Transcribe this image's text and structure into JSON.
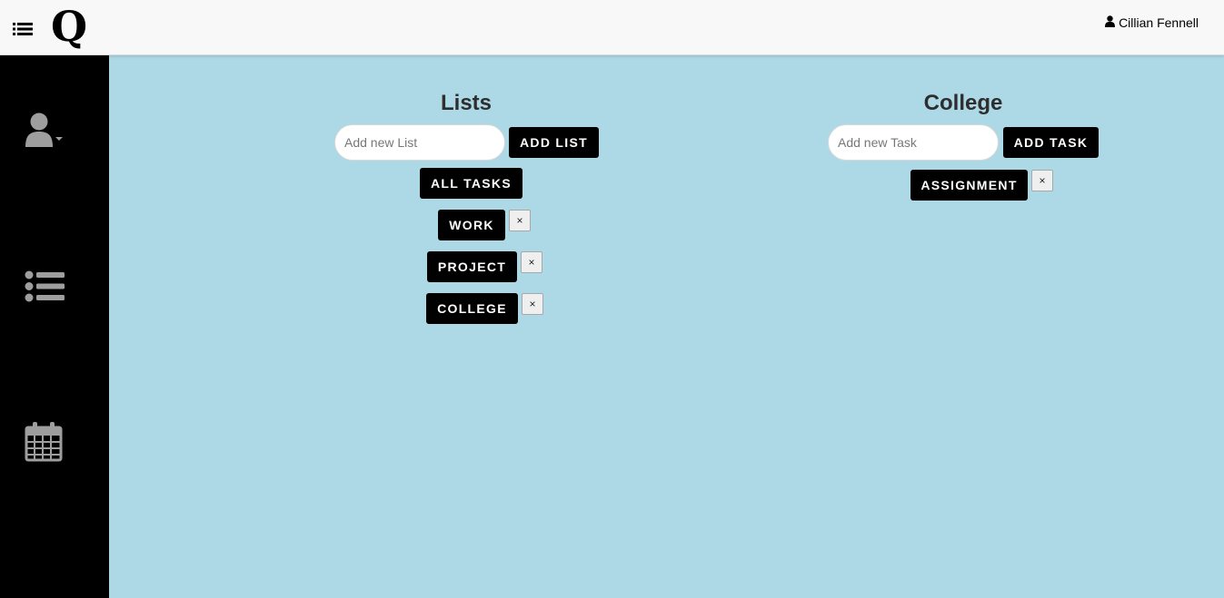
{
  "header": {
    "logo_text": "Q",
    "user_name": "Cillian Fennell",
    "icons": {
      "menu": "list-icon",
      "user": "user-icon"
    }
  },
  "sidebar": {
    "items": [
      {
        "icon": "user-profile-icon"
      },
      {
        "icon": "list-icon"
      },
      {
        "icon": "calendar-icon"
      }
    ]
  },
  "lists_panel": {
    "title": "Lists",
    "input_placeholder": "Add new List",
    "input_value": "",
    "add_button": "ADD LIST",
    "all_tasks_button": "ALL TASKS",
    "lists": [
      {
        "label": "WORK",
        "delete_label": "×"
      },
      {
        "label": "PROJECT",
        "delete_label": "×"
      },
      {
        "label": "COLLEGE",
        "delete_label": "×"
      }
    ]
  },
  "tasks_panel": {
    "title": "College",
    "input_placeholder": "Add new Task",
    "input_value": "",
    "add_button": "ADD TASK",
    "tasks": [
      {
        "label": "ASSIGNMENT",
        "delete_label": "×"
      }
    ]
  },
  "colors": {
    "background": "#add8e6",
    "sidebar": "#000000",
    "navbar": "#f8f8f8",
    "button": "#000000",
    "button_text": "#ffffff",
    "sidebar_icon": "#9e9e9e"
  }
}
